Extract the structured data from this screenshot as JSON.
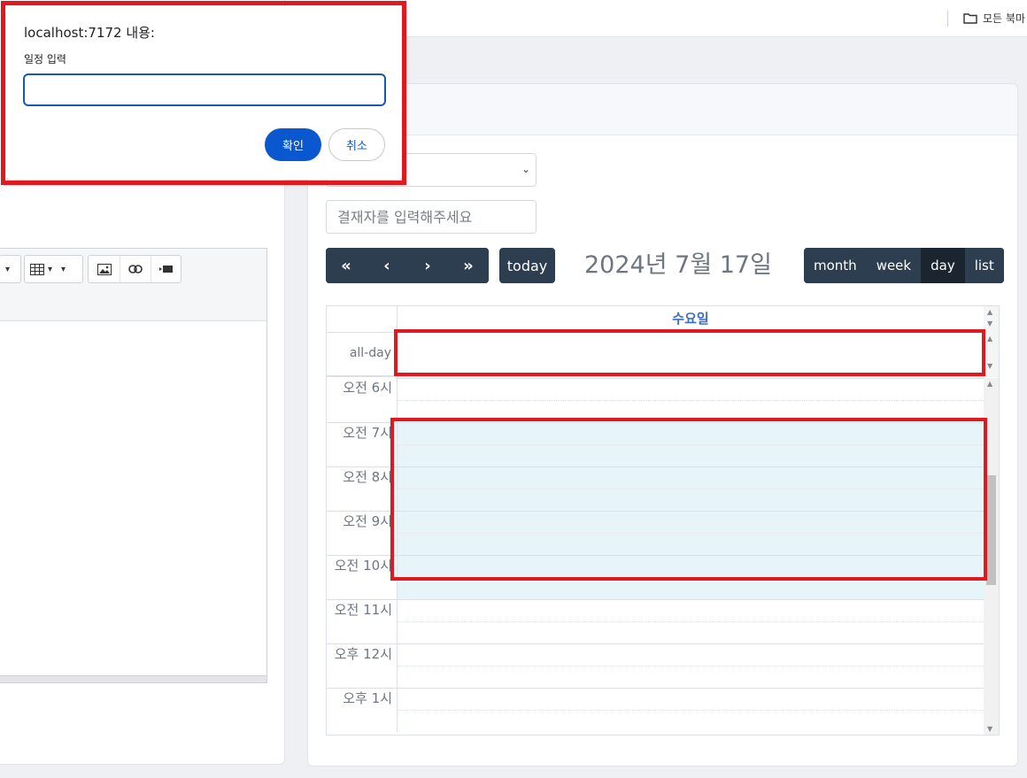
{
  "bookmark_bar": {
    "folder_label": "모든 북마"
  },
  "dialog": {
    "title": "localhost:7172 내용:",
    "message": "일정 입력",
    "input_value": "",
    "ok_label": "확인",
    "cancel_label": "취소"
  },
  "form": {
    "select_value": "",
    "approver_placeholder": "결재자를 입력해주세요"
  },
  "calendar": {
    "nav": {
      "prev_year": "«",
      "prev": "‹",
      "next": "›",
      "next_year": "»"
    },
    "today_label": "today",
    "title": "2024년 7월 17일",
    "views": [
      "month",
      "week",
      "day",
      "list"
    ],
    "active_view": "day",
    "day_header": "수요일",
    "allday_label": "all-day",
    "time_slots": [
      "오전 6시",
      "오전 7시",
      "오전 8시",
      "오전 9시",
      "오전 10시",
      "오전 11시",
      "오후 12시",
      "오후 1시"
    ],
    "selected_range": "오전 7시 – 오전 11시"
  },
  "colors": {
    "toolbar_button": "#2c3e50",
    "active_button": "#1a252f",
    "selection_fill": "#e7f5fb",
    "highlight_border": "#e0191f",
    "dialog_ok": "#0b57d0"
  },
  "icons": [
    "folder-icon",
    "table-icon",
    "image-icon",
    "link-icon",
    "video-icon",
    "chevron-down-icon"
  ]
}
